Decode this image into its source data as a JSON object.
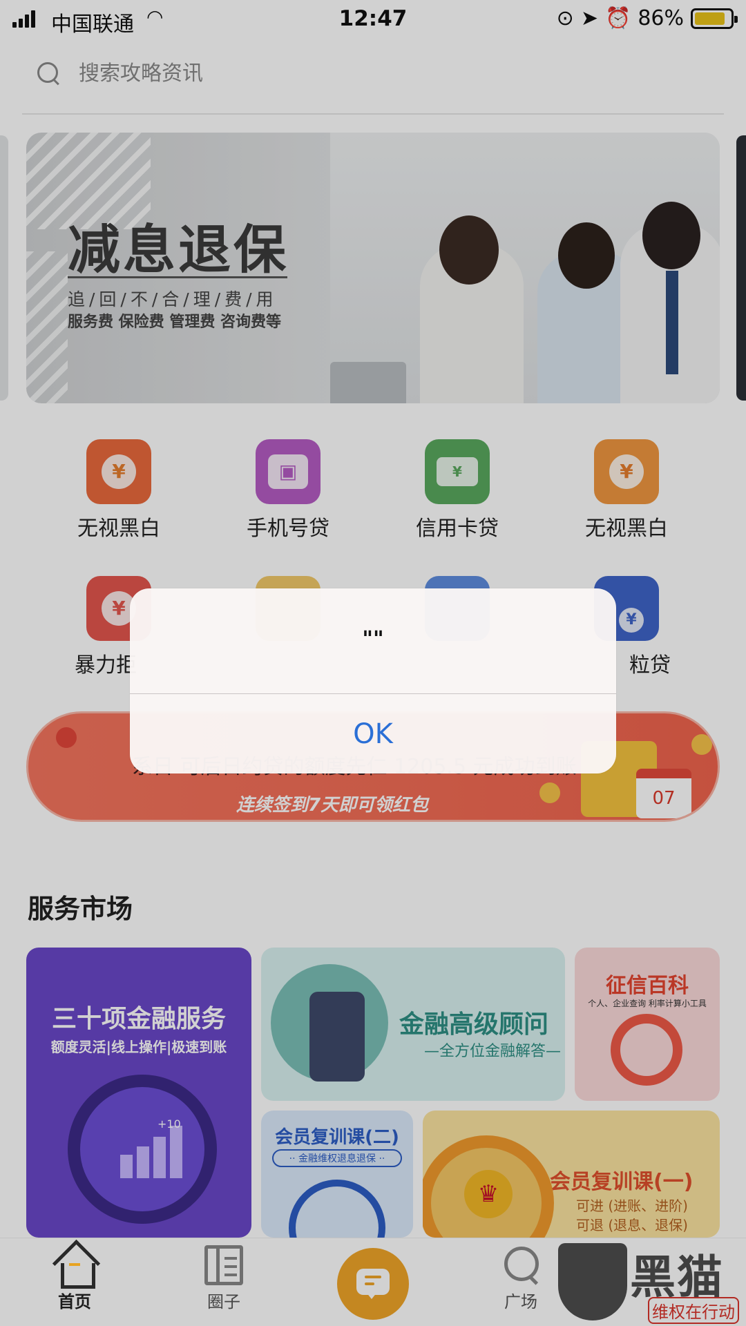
{
  "status_bar": {
    "carrier": "中国联通",
    "time": "12:47",
    "battery": "86%",
    "battery_level": 0.86
  },
  "search": {
    "placeholder": "搜索攻略资讯"
  },
  "banner": {
    "title": "减息退保",
    "subtitle": "追/回/不/合/理/费/用",
    "fees": "服务费 保险费 管理费 咨询费等"
  },
  "grid": [
    {
      "label": "无视黑白",
      "icon": "coin-hand-icon",
      "color": "#e96a3c"
    },
    {
      "label": "手机号贷",
      "icon": "phone-card-icon",
      "color": "#b55cc4"
    },
    {
      "label": "信用卡贷",
      "icon": "credit-card-icon",
      "color": "#5aa95e"
    },
    {
      "label": "无视黑白",
      "icon": "coin-icon",
      "color": "#ef9740"
    },
    {
      "label": "暴力拒",
      "icon": "coin-hand-icon",
      "color": "#e3564e"
    },
    {
      "label": "粒贷",
      "icon": "wallet-icon",
      "color": "#3f64c8"
    }
  ],
  "signin": {
    "main": "系日      可后日约贷的额度先仁    1205.5    元成功到账",
    "sub": "连续签到7天即可领红包",
    "calendar_day": "07"
  },
  "section": {
    "title": "服务市场"
  },
  "cards": {
    "c1": {
      "title": "三十项金融服务",
      "sub": "额度灵活|线上操作|极速到账",
      "plus": "+10"
    },
    "c2": {
      "title": "金融高级顾问",
      "sub": "—全方位金融解答—"
    },
    "c3": {
      "title": "征信百科",
      "sub": "个人、企业查询  利率计算小工具"
    },
    "c4": {
      "title": "会员复训课(二)",
      "sub": "·· 金融维权退息退保 ··"
    },
    "c5": {
      "title": "会员复训课(一)",
      "line1": "可进  (进账、进阶)",
      "line2": "可退  (退息、退保)"
    }
  },
  "tabbar": {
    "home": "首页",
    "circle": "圈子",
    "square": "广场"
  },
  "watermark": {
    "text": "黑猫",
    "sub": "维权在行动"
  },
  "alert": {
    "message": "\"\"",
    "ok_label": "OK"
  }
}
